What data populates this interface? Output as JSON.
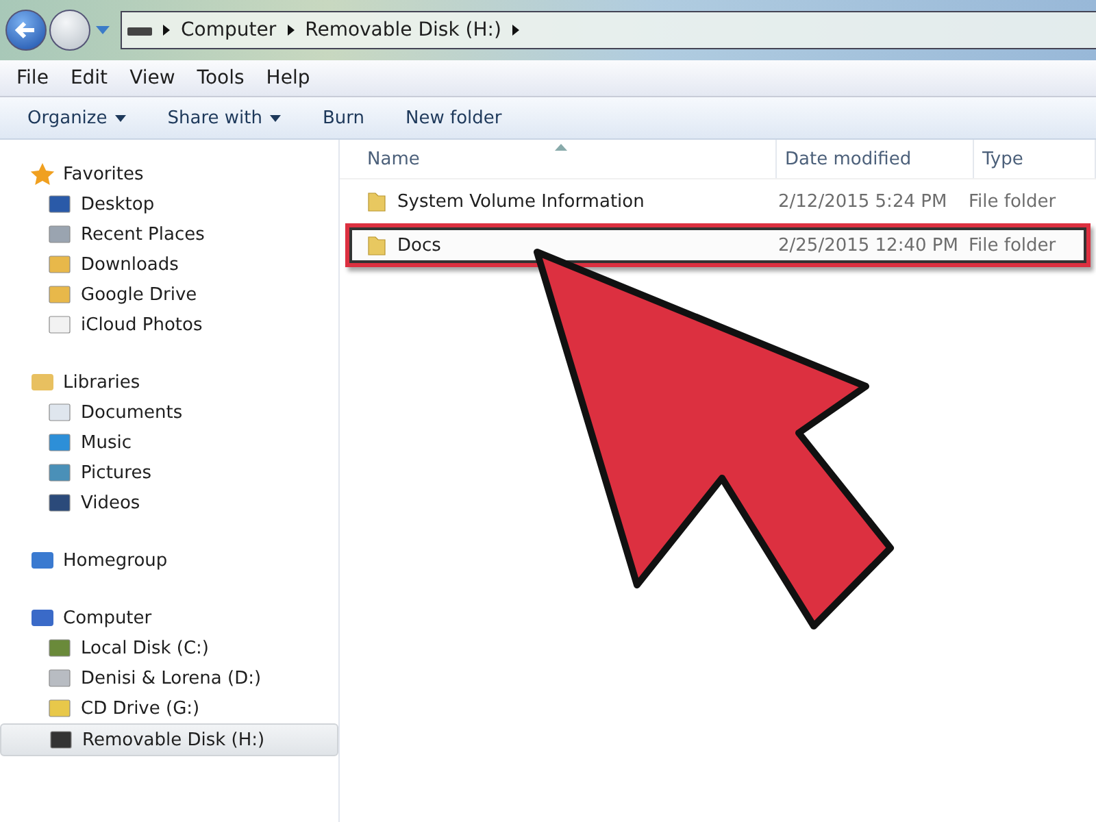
{
  "address_bar": {
    "crumbs": [
      "Computer",
      "Removable Disk (H:)"
    ]
  },
  "menu_bar": [
    "File",
    "Edit",
    "View",
    "Tools",
    "Help"
  ],
  "toolbar": [
    {
      "label": "Organize",
      "dropdown": true
    },
    {
      "label": "Share with",
      "dropdown": true
    },
    {
      "label": "Burn",
      "dropdown": false
    },
    {
      "label": "New folder",
      "dropdown": false
    }
  ],
  "sidebar": [
    {
      "label": "Favorites",
      "items": [
        {
          "label": "Desktop",
          "selected": false
        },
        {
          "label": "Recent Places",
          "selected": false
        },
        {
          "label": "Downloads",
          "selected": false
        },
        {
          "label": "Google Drive",
          "selected": false
        },
        {
          "label": "iCloud Photos",
          "selected": false
        }
      ]
    },
    {
      "label": "Libraries",
      "items": [
        {
          "label": "Documents",
          "selected": false
        },
        {
          "label": "Music",
          "selected": false
        },
        {
          "label": "Pictures",
          "selected": false
        },
        {
          "label": "Videos",
          "selected": false
        }
      ]
    },
    {
      "label": "Homegroup"
    },
    {
      "label": "Computer",
      "items": [
        {
          "label": "Local Disk (C:)",
          "selected": false
        },
        {
          "label": "Denisi & Lorena (D:)",
          "selected": false
        },
        {
          "label": "CD Drive (G:)",
          "selected": false
        },
        {
          "label": "Removable Disk (H:)",
          "selected": true
        }
      ]
    }
  ],
  "file_list": {
    "columns": [
      "Name",
      "Date modified",
      "Type"
    ],
    "rows": [
      {
        "name": "System Volume Information",
        "date": "2/12/2015 5:24 PM",
        "type": "File folder",
        "highlighted": false
      },
      {
        "name": "Docs",
        "date": "2/25/2015 12:40 PM",
        "type": "File folder",
        "highlighted": true
      }
    ]
  }
}
